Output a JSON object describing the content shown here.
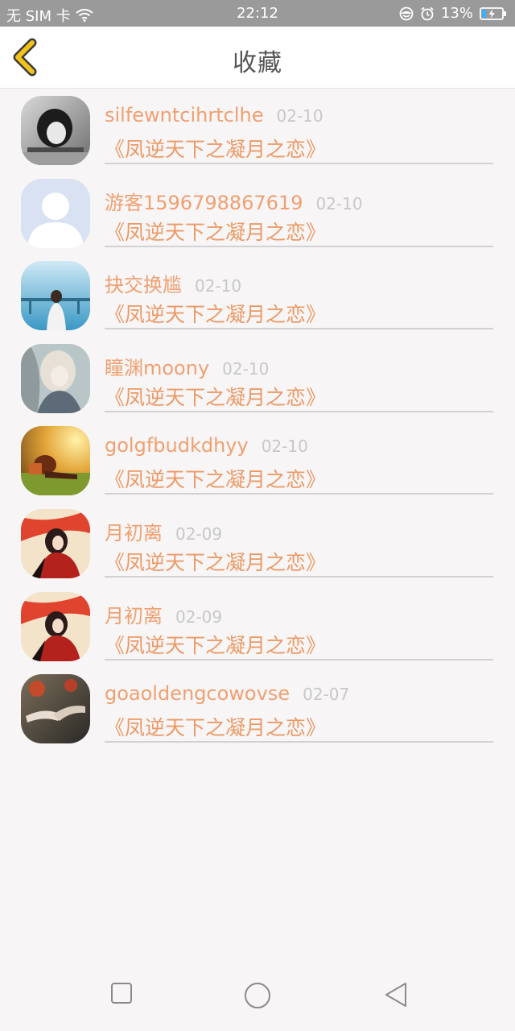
{
  "status_bar": {
    "carrier": "无 SIM 卡",
    "time": "22:12",
    "battery": "13%"
  },
  "header": {
    "title": "收藏",
    "back_icon": "chevron-left-icon",
    "accent_color": "#f2c21b"
  },
  "list": [
    {
      "name": "silfewntcihrtclhe",
      "date": "02-10",
      "book": "《凤逆天下之凝月之恋》"
    },
    {
      "name": "游客1596798867619",
      "date": "02-10",
      "book": "《凤逆天下之凝月之恋》"
    },
    {
      "name": "抉交换尴",
      "date": "02-10",
      "book": "《凤逆天下之凝月之恋》"
    },
    {
      "name": "瞳渊moony",
      "date": "02-10",
      "book": "《凤逆天下之凝月之恋》"
    },
    {
      "name": "golgfbudkdhyy",
      "date": "02-10",
      "book": "《凤逆天下之凝月之恋》"
    },
    {
      "name": "月初离",
      "date": "02-09",
      "book": "《凤逆天下之凝月之恋》"
    },
    {
      "name": "月初离",
      "date": "02-09",
      "book": "《凤逆天下之凝月之恋》"
    },
    {
      "name": "goaoldengcowovse",
      "date": "02-07",
      "book": "《凤逆天下之凝月之恋》"
    }
  ],
  "colors": {
    "name_text": "#f0a070",
    "date_text": "#c8c8c8",
    "book_text": "#ec9a66",
    "background": "#f7f5f6"
  }
}
